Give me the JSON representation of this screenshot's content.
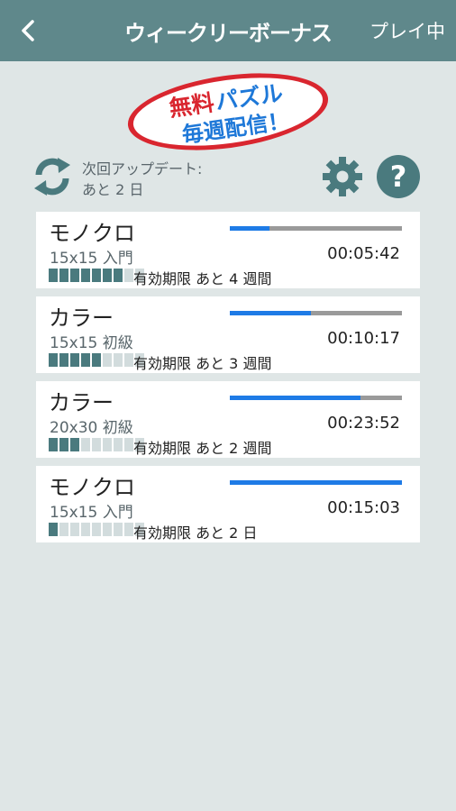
{
  "header": {
    "title": "ウィークリーボーナス",
    "action_label": "プレイ中",
    "back_icon": "chevron-left-icon"
  },
  "banner": {
    "line1_a": "無料",
    "line1_b": "パズル",
    "line2": "毎週配信！"
  },
  "update": {
    "label_line1": "次回アップデート:",
    "label_line2": "あと 2 日",
    "refresh_icon": "refresh-icon",
    "settings_icon": "gear-icon",
    "help_icon": "help-icon"
  },
  "colors": {
    "appbar": "#5f888b",
    "progress_fill": "#1e7be6",
    "progress_track": "#9a9a9a",
    "segment_on": "#4a7a7e",
    "segment_off": "#d2dcdd",
    "banner_red": "#d9262f"
  },
  "puzzles": [
    {
      "title": "モノクロ",
      "level": "15x15 入門",
      "time": "00:05:42",
      "progress": 0.23,
      "weeks_filled": 7,
      "weeks_total": 9,
      "expiry": "有効期限 あと 4 週間"
    },
    {
      "title": "カラー",
      "level": "15x15 初級",
      "time": "00:10:17",
      "progress": 0.47,
      "weeks_filled": 5,
      "weeks_total": 9,
      "expiry": "有効期限 あと 3 週間"
    },
    {
      "title": "カラー",
      "level": "20x30 初級",
      "time": "00:23:52",
      "progress": 0.76,
      "weeks_filled": 3,
      "weeks_total": 9,
      "expiry": "有効期限 あと 2 週間"
    },
    {
      "title": "モノクロ",
      "level": "15x15 入門",
      "time": "00:15:03",
      "progress": 1.0,
      "weeks_filled": 1,
      "weeks_total": 9,
      "expiry": "有効期限 あと 2 日"
    }
  ]
}
